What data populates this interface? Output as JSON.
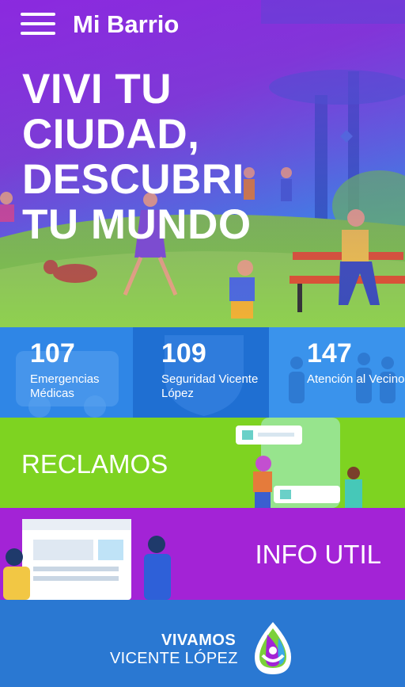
{
  "header": {
    "title": "Mi Barrio",
    "menu_icon": "hamburger-menu-icon"
  },
  "hero": {
    "headline_lines": [
      "VIVI TU",
      "CIUDAD,",
      "DESCUBRI",
      "TU MUNDO"
    ]
  },
  "emergency": [
    {
      "number": "107",
      "label": "Emergencias Médicas",
      "icon": "ambulance-icon"
    },
    {
      "number": "109",
      "label": "Seguridad Vicente López",
      "icon": "police-shield-icon"
    },
    {
      "number": "147",
      "label": "Atención al Vecino",
      "icon": "people-group-icon"
    }
  ],
  "sections": {
    "reclamos_label": "RECLAMOS",
    "info_label": "INFO UTIL"
  },
  "footer": {
    "brand_line1": "VIVAMOS",
    "brand_line2": "VICENTE LÓPEZ",
    "logo_icon": "vivamos-drop-logo-icon"
  },
  "colors": {
    "hero_purple": "#8a2be2",
    "emergency_blue": "#2f86e6",
    "reclamos_green": "#7ed321",
    "info_purple": "#a323d6",
    "footer_blue": "#2a78d2"
  }
}
